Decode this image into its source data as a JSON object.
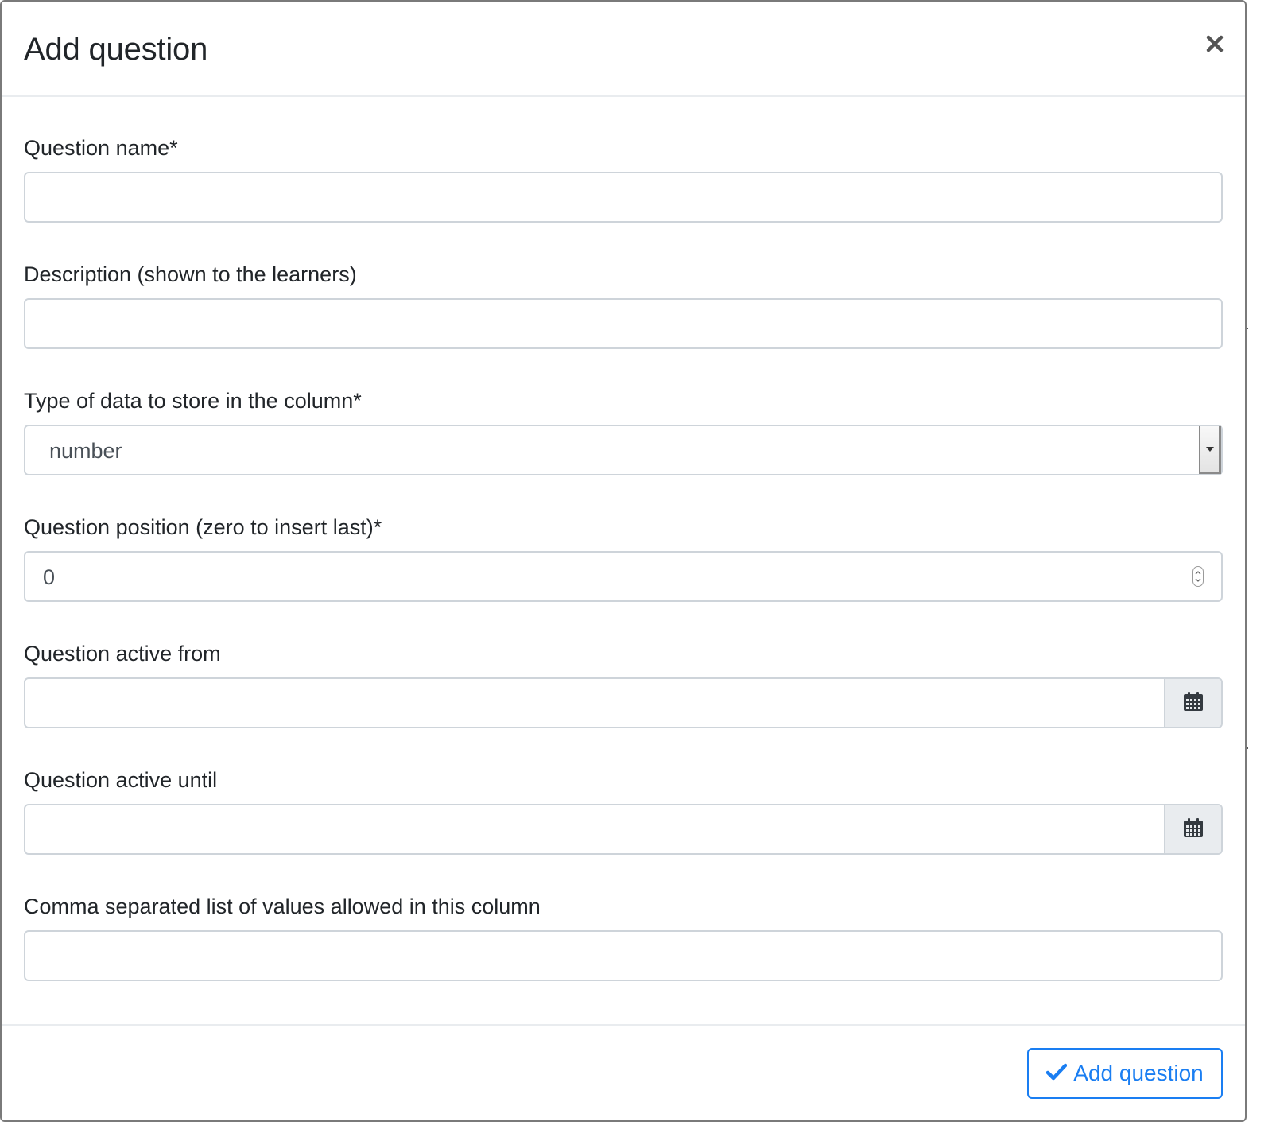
{
  "modal": {
    "title": "Add question"
  },
  "form": {
    "question_name": {
      "label": "Question name*",
      "value": ""
    },
    "description": {
      "label": "Description (shown to the learners)",
      "value": ""
    },
    "data_type": {
      "label": "Type of data to store in the column*",
      "selected": "number"
    },
    "position": {
      "label": "Question position (zero to insert last)*",
      "value": "0"
    },
    "active_from": {
      "label": "Question active from",
      "value": ""
    },
    "active_until": {
      "label": "Question active until",
      "value": ""
    },
    "allowed_values": {
      "label": "Comma separated list of values allowed in this column",
      "value": ""
    }
  },
  "footer": {
    "submit_label": "Add question"
  },
  "colors": {
    "primary": "#1a7ef2",
    "text": "#212529",
    "border": "#ced4da",
    "addon_bg": "#e9ecef"
  },
  "icons": {
    "close": "close-icon",
    "dropdown": "caret-down-icon",
    "spinner": "spinner-icon",
    "calendar": "calendar-icon",
    "check": "check-icon"
  }
}
